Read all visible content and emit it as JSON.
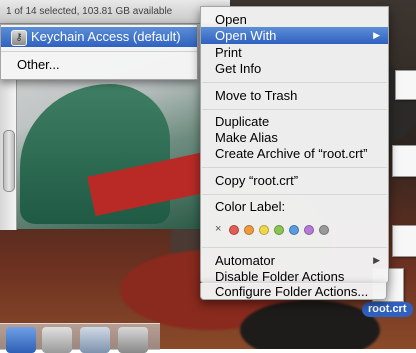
{
  "status_bar": {
    "text": "1 of 14 selected, 103.81 GB available"
  },
  "submenu": {
    "items": [
      {
        "label": "Keychain Access (default)",
        "icon": "keychain-icon"
      },
      {
        "label": "Other..."
      }
    ]
  },
  "context_menu": {
    "items": [
      {
        "label": "Open"
      },
      {
        "label": "Open With",
        "has_submenu": true,
        "highlighted": true
      },
      {
        "label": "Print"
      },
      {
        "label": "Get Info"
      },
      {
        "label": "Move to Trash"
      },
      {
        "label": "Duplicate"
      },
      {
        "label": "Make Alias"
      },
      {
        "label": "Create Archive of “root.crt”"
      },
      {
        "label": "Copy “root.crt”"
      },
      {
        "label": "Color Label:"
      },
      {
        "label": "Automator",
        "has_submenu": true
      },
      {
        "label": "Disable Folder Actions"
      },
      {
        "label": "Configure Folder Actions..."
      }
    ],
    "color_labels": {
      "none_symbol": "×",
      "colors": [
        "#e35b55",
        "#f09a3b",
        "#f2d64a",
        "#8ac54f",
        "#5a9be0",
        "#b57ad7",
        "#9a9a9a"
      ]
    },
    "submenu_arrow": "▶"
  },
  "desktop": {
    "file_labels": [
      "root.crt"
    ]
  },
  "colors": {
    "highlight": "#2f61c1",
    "menu_bg": "#f4f4f4"
  }
}
